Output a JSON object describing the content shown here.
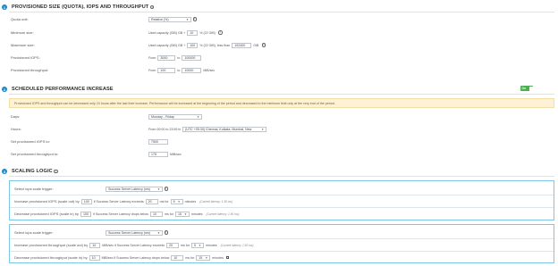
{
  "sections": {
    "provisioned": {
      "number": "1",
      "title": "PROVISIONED SIZE (QUOTA), IOPS AND THROUGHPUT"
    },
    "scheduled": {
      "number": "2",
      "title": "SCHEDULED PERFORMANCE INCREASE"
    },
    "scaling": {
      "number": "3",
      "title": "SCALING LOGIC"
    }
  },
  "provisioned": {
    "quota_unit_label": "Quota unit:",
    "quota_unit_value": "Relative (%)",
    "min_size_label": "Minimum size:",
    "min_size_prefix": "Used capacity (GiB) GB +",
    "min_size_value": "10",
    "min_size_suffix": "% (22 GiB)",
    "max_size_label": "Maximum size:",
    "max_size_prefix": "Used capacity (GiB) GB +",
    "max_size_value": "100",
    "max_size_suffix": "% (22 GiB), less than",
    "max_size_limit": "102400",
    "max_size_unit": "GiB",
    "iops_label": "Provisioned IOPS:",
    "iops_from_label": "From",
    "iops_from": "3000",
    "iops_to_label": "to",
    "iops_to": "100000",
    "throughput_label": "Provisioned throughput:",
    "throughput_from_label": "From",
    "throughput_from": "100",
    "throughput_to_label": "to",
    "throughput_to": "10000",
    "throughput_unit": "MiB/sec"
  },
  "scheduled": {
    "toggle_label": "On",
    "notice": "Provisioned IOPS and throughput can be decreased only 24 hours after the last their increase. Performance will be increased at the beginning of the period and decreased to the minimum limit only at the very end of the period.",
    "days_label": "Days:",
    "days_value": "Monday - Friday",
    "hours_label": "Hours:",
    "hours_prefix": "From 00:00 to 23:59 in",
    "hours_timezone": "(UTC +05:30) Chennai, Kolkata, Mumbai, New",
    "iops_label": "Set provisioned IOPS to:",
    "iops_value": "7500",
    "throughput_label": "Set provisioned throughput to:",
    "throughput_value": "175",
    "throughput_unit": "MiB/sec"
  },
  "scaling": {
    "panel1": {
      "trigger_label": "Select iops scale trigger:",
      "trigger_value": "Success Server Latency (ms)",
      "increase_label": "Increase provisioned IOPS (scale out) by",
      "increase_value": "100",
      "increase_mid": "if Success Server Latency exceeds",
      "increase_threshold": "20",
      "increase_for": "ms for",
      "increase_minutes": "5",
      "increase_unit": "minutes",
      "increase_note": "(Current latency: 1.50 ms)",
      "decrease_label": "Decrease provisioned IOPS (scale in) by",
      "decrease_value": "100",
      "decrease_mid": "if Success Server Latency drops below",
      "decrease_threshold": "10",
      "decrease_for": "ms for",
      "decrease_minutes": "15",
      "decrease_unit": "minutes",
      "decrease_note": "(Current latency: 1.50 ms)"
    },
    "panel2": {
      "trigger_label": "Select iops scale trigger:",
      "trigger_value": "Success Server Latency (ms)",
      "increase_label": "Increase provisioned throughput (scale out) by",
      "increase_value": "10",
      "increase_mid": "MiB/sec if Success Server Latency exceeds",
      "increase_threshold": "20",
      "increase_for": "ms for",
      "increase_minutes": "5",
      "increase_unit": "minutes",
      "increase_note": "(Current latency: 1.50 ms)",
      "decrease_label": "Decrease provisioned throughput (scale in) by",
      "decrease_value": "10",
      "decrease_mid": "MiB/sec if Success Server Latency drops below",
      "decrease_threshold": "10",
      "decrease_for": "ms for",
      "decrease_minutes": "15",
      "decrease_unit": "minutes"
    }
  },
  "colors": {
    "accent": "#1e88c9",
    "toggle_on": "#4caf50",
    "notice_bg": "#fdf2d5",
    "panel_border": "#7cc7e6"
  },
  "icons": {
    "info": "info-icon",
    "caret": "chevron-down-icon",
    "checkbox": "checkbox-icon"
  }
}
